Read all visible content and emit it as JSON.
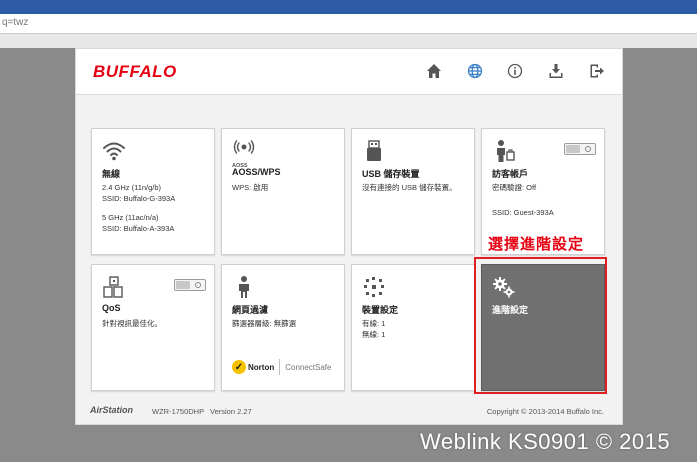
{
  "browser": {
    "url_fragment": "q=twz"
  },
  "header": {
    "logo": "BUFFALO"
  },
  "tiles": [
    {
      "id": "wireless",
      "title": "無線",
      "lines": [
        "2.4 GHz (11n/g/b)",
        "SSID: Buffalo-G-393A",
        "",
        "5 GHz (11ac/n/a)",
        "SSID: Buffalo-A-393A"
      ]
    },
    {
      "id": "aoss",
      "icon_caption": "AOSS",
      "title": "AOSS/WPS",
      "lines": [
        "WPS: 啟用"
      ]
    },
    {
      "id": "usb",
      "title": "USB 儲存裝置",
      "lines": [
        "沒有連接的 USB 儲存裝置。"
      ]
    },
    {
      "id": "guest",
      "title": "訪客帳戶",
      "lines": [
        "密碼驗證: Off",
        "",
        "SSID: Guest-393A"
      ]
    },
    {
      "id": "qos",
      "title": "QoS",
      "lines": [
        "針對視訊最佳化。"
      ]
    },
    {
      "id": "filter",
      "title": "網頁過濾",
      "lines": [
        "篩選器層級: 無篩選"
      ],
      "norton": {
        "brand": "Norton",
        "product": "ConnectSafe"
      }
    },
    {
      "id": "devices",
      "title": "裝置設定",
      "lines": [
        "有線: 1",
        "無線: 1"
      ]
    },
    {
      "id": "advanced",
      "title": "進階設定",
      "lines": []
    }
  ],
  "annotation": "選擇進階設定",
  "footer": {
    "brand": "AirStation",
    "model": "WZR-1750DHP",
    "version": "Version 2.27",
    "copyright": "Copyright © 2013-2014 Buffalo Inc."
  },
  "watermark": "Weblink KS0901 © 2015",
  "colors": {
    "brand_red": "#e60012",
    "tile_active": "#707070",
    "annotation_box": "#e02020"
  },
  "icons": [
    "home-icon",
    "globe-icon",
    "info-icon",
    "download-icon",
    "logout-icon",
    "wifi-icon",
    "aoss-icon",
    "usb-icon",
    "guest-user-icon",
    "qos-icon",
    "person-filter-icon",
    "devices-icon",
    "gears-icon"
  ]
}
